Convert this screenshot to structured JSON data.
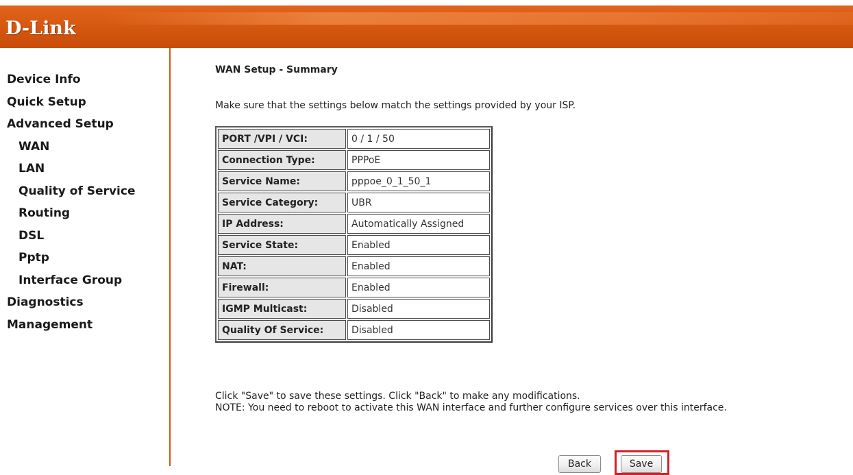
{
  "brand": {
    "logo": "D-Link",
    "accent_color": "#d4570f"
  },
  "sidebar": {
    "items": [
      {
        "label": "Device Info",
        "level": 0
      },
      {
        "label": "Quick Setup",
        "level": 0
      },
      {
        "label": "Advanced Setup",
        "level": 0
      },
      {
        "label": "WAN",
        "level": 1
      },
      {
        "label": "LAN",
        "level": 1
      },
      {
        "label": "Quality of Service",
        "level": 1
      },
      {
        "label": "Routing",
        "level": 1
      },
      {
        "label": "DSL",
        "level": 1
      },
      {
        "label": "Pptp",
        "level": 1
      },
      {
        "label": "Interface Group",
        "level": 1
      },
      {
        "label": "Diagnostics",
        "level": 0
      },
      {
        "label": "Management",
        "level": 0
      }
    ]
  },
  "main": {
    "title": "WAN Setup - Summary",
    "intro": "Make sure that the settings below match the settings provided by your ISP.",
    "summary": [
      {
        "label": "PORT /VPI / VCI:",
        "value": "0 / 1 / 50"
      },
      {
        "label": "Connection Type:",
        "value": "PPPoE"
      },
      {
        "label": "Service Name:",
        "value": "pppoe_0_1_50_1"
      },
      {
        "label": "Service Category:",
        "value": "UBR"
      },
      {
        "label": "IP Address:",
        "value": "Automatically Assigned"
      },
      {
        "label": "Service State:",
        "value": "Enabled"
      },
      {
        "label": "NAT:",
        "value": "Enabled"
      },
      {
        "label": "Firewall:",
        "value": "Enabled"
      },
      {
        "label": "IGMP Multicast:",
        "value": "Disabled"
      },
      {
        "label": "Quality Of Service:",
        "value": "Disabled"
      }
    ],
    "note_line1": "Click \"Save\" to save these settings. Click \"Back\" to make any modifications.",
    "note_line2": "NOTE: You need to reboot to activate this WAN interface and further configure services over this interface.",
    "back_label": "Back",
    "save_label": "Save",
    "highlight_color": "#d0202a"
  }
}
